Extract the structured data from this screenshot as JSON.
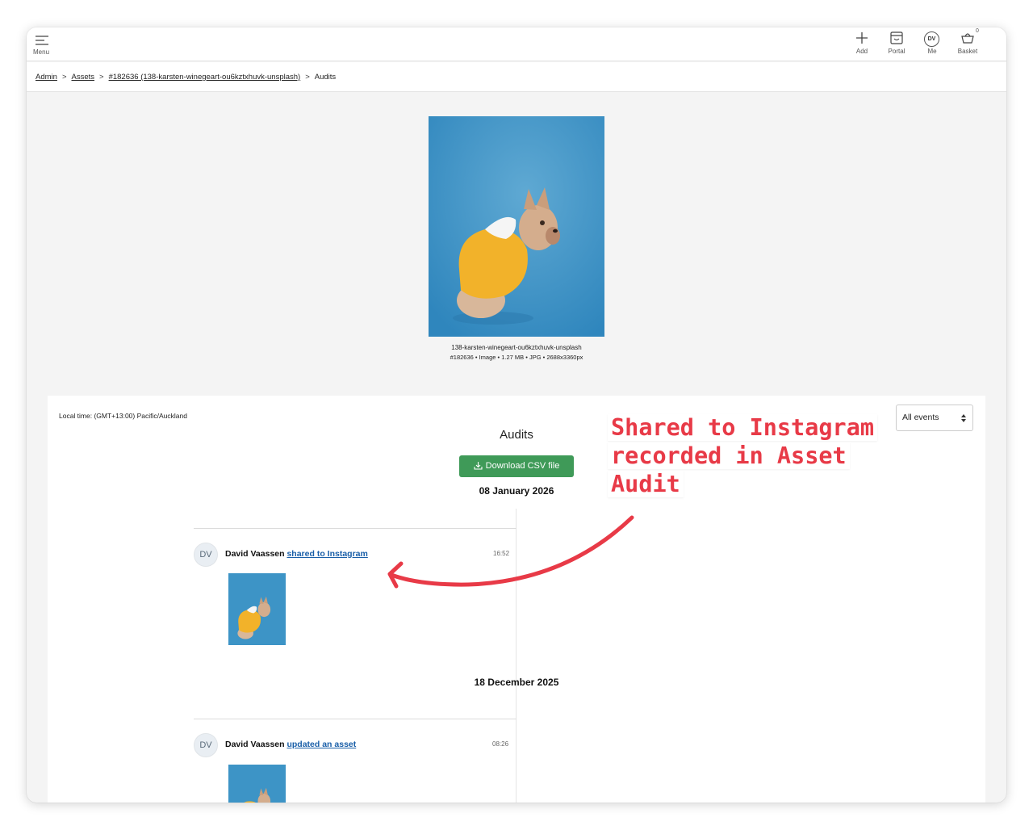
{
  "topbar": {
    "menu_label": "Menu",
    "add_label": "Add",
    "portal_label": "Portal",
    "me_label": "Me",
    "me_initials": "DV",
    "basket_label": "Basket",
    "basket_count": "0"
  },
  "breadcrumb": {
    "items": [
      "Admin",
      "Assets",
      "#182636 (138-karsten-winegeart-ou6kztxhuvk-unsplash)"
    ],
    "current": "Audits",
    "separator": ">"
  },
  "asset": {
    "file_name": "138-karsten-winegeart-ou6kztxhuvk-unsplash",
    "meta": "#182636 • Image  • 1.27 MB • JPG • 2688x3360px"
  },
  "audits": {
    "local_time": "Local time: (GMT+13:00) Pacific/Auckland",
    "filter_value": "All events",
    "title": "Audits",
    "download_label": "Download CSV file",
    "groups": [
      {
        "date": "08 January 2026",
        "entries": [
          {
            "initials": "DV",
            "user": "David Vaassen",
            "action": "shared to Instagram",
            "time": "16:52"
          }
        ]
      },
      {
        "date": "18 December 2025",
        "entries": [
          {
            "initials": "DV",
            "user": "David Vaassen",
            "action": "updated an asset",
            "time": "08:26"
          }
        ]
      }
    ]
  },
  "annotation": {
    "lines": [
      "Shared to Instagram",
      "recorded in Asset",
      "Audit"
    ],
    "color": "#e83a47"
  },
  "colors": {
    "accent_green": "#3f9a58",
    "link_blue": "#1a5fa8",
    "photo_blue": "#3d94c6",
    "hoodie_yellow": "#f2b22a"
  }
}
